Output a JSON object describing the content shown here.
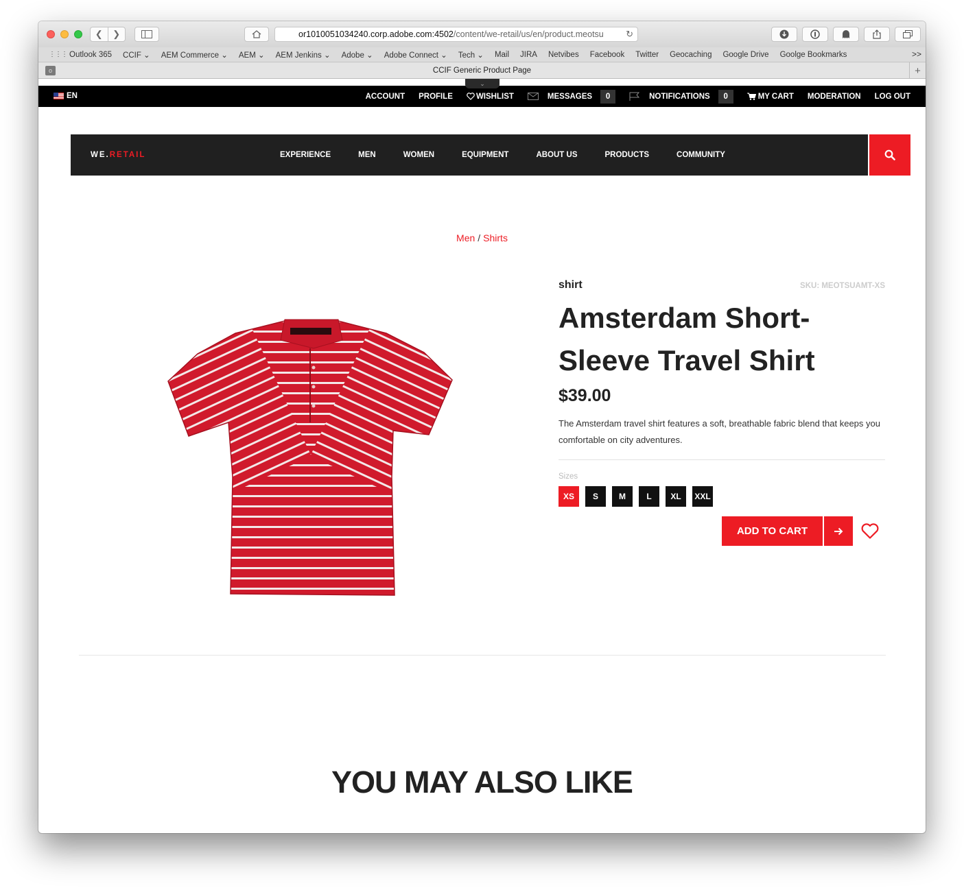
{
  "browser": {
    "url_host": "or1010051034240.corp.adobe.com:4502",
    "url_path": "/content/we-retail/us/en/product.meotsu",
    "tab_title": "CCIF Generic Product Page",
    "bookmarks": [
      "Outlook 365",
      "CCIF ⌄",
      "AEM Commerce ⌄",
      "AEM ⌄",
      "AEM Jenkins ⌄",
      "Adobe ⌄",
      "Adobe Connect ⌄",
      "Tech ⌄",
      "Mail",
      "JIRA",
      "Netvibes",
      "Facebook",
      "Twitter",
      "Geocaching",
      "Google Drive",
      "Goolge Bookmarks"
    ],
    "bookmarks_more": ">>"
  },
  "utility": {
    "lang": "EN",
    "account": "ACCOUNT",
    "profile": "PROFILE",
    "wishlist": "WISHLIST",
    "messages": "MESSAGES",
    "messages_count": "0",
    "notifications": "NOTIFICATIONS",
    "notifications_count": "0",
    "cart": "MY CART",
    "moderation": "MODERATION",
    "logout": "LOG OUT"
  },
  "nav": {
    "logo_prefix": "WE.",
    "logo_suffix": "RETAIL",
    "links": [
      "EXPERIENCE",
      "MEN",
      "WOMEN",
      "EQUIPMENT",
      "ABOUT US",
      "PRODUCTS",
      "COMMUNITY"
    ]
  },
  "breadcrumb": {
    "parent": "Men",
    "separator": "/",
    "current": "Shirts"
  },
  "product": {
    "category": "shirt",
    "sku": "SKU: MEOTSUAMT-XS",
    "name": "Amsterdam Short-Sleeve Travel Shirt",
    "price": "$39.00",
    "description": "The Amsterdam travel shirt features a soft, breathable fabric blend that keeps you comfortable on city adventures.",
    "sizes_label": "Sizes",
    "sizes": [
      "XS",
      "S",
      "M",
      "L",
      "XL",
      "XXL"
    ],
    "selected_size": "XS",
    "add_to_cart": "ADD TO CART"
  },
  "related": {
    "heading": "YOU MAY ALSO LIKE"
  },
  "colors": {
    "accent": "#ed1c24",
    "nav_bg": "#202020",
    "utility_bg": "#000000"
  }
}
